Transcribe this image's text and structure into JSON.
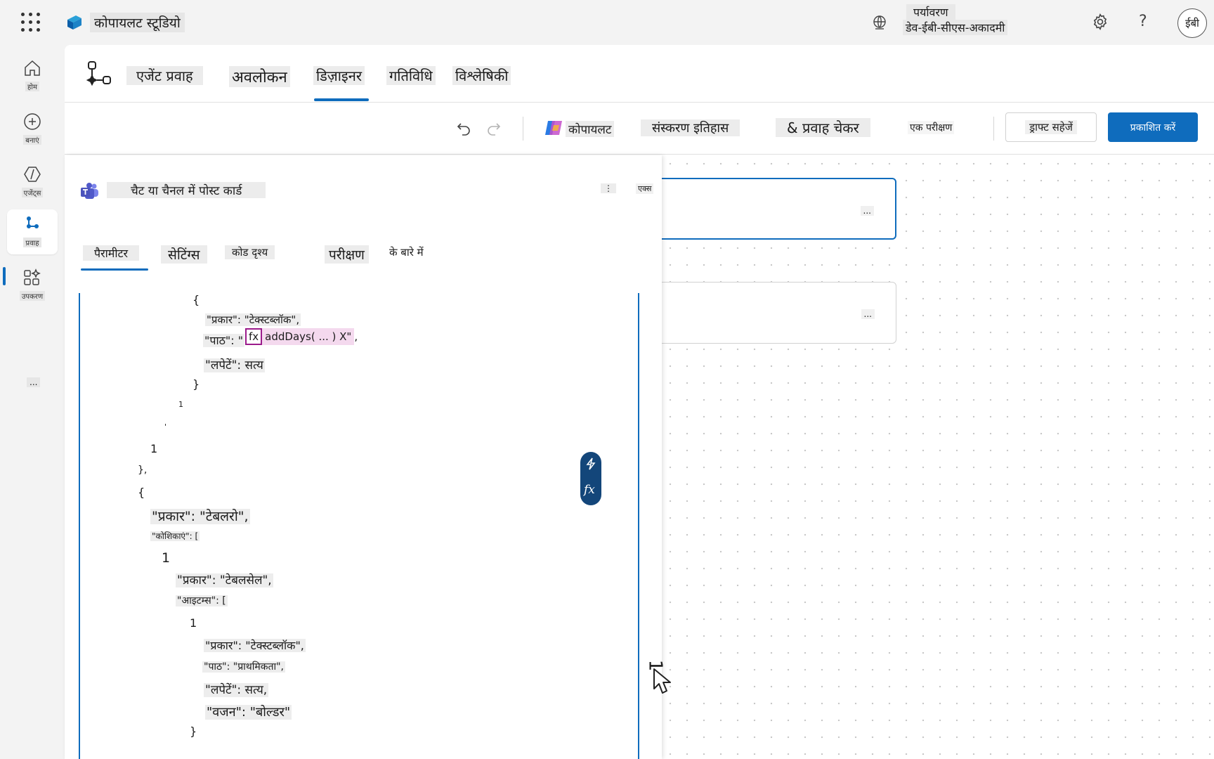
{
  "app": {
    "name": "कोपायलट स्टूडियो",
    "environment_label": "पर्यावरण",
    "environment_value": "डेव-ईबी-सीएस-अकादमी",
    "help_label": "?",
    "avatar_initials": "ईबी",
    "brand_color": "#0f6cbd"
  },
  "leftnav": {
    "items": [
      {
        "label": "होम",
        "icon": "home-icon"
      },
      {
        "label": "बनाएं",
        "icon": "plus-circle-icon"
      },
      {
        "label": "एजेंट्स",
        "icon": "agents-icon"
      },
      {
        "label": "प्रवाह",
        "icon": "flow-icon"
      },
      {
        "label": "उपकरण",
        "icon": "tools-icon"
      }
    ],
    "more": "..."
  },
  "flow_header": {
    "tabs": [
      "एजेंट प्रवाह",
      "अवलोकन",
      "डिज़ाइनर",
      "गतिविधि",
      "विश्लेषिकी"
    ],
    "active_tab": "डिज़ाइनर"
  },
  "toolbar": {
    "copilot": "कोपायलट",
    "version_history": "संस्करण इतिहास",
    "flow_checker": "& प्रवाह चेकर",
    "test": "एक परीक्षण",
    "save_draft": "ड्राफ्ट सहेजें",
    "publish": "प्रकाशित करें"
  },
  "panel": {
    "title": "चैट या चैनल में पोस्ट कार्ड",
    "more": "⋮",
    "close": "एक्स",
    "tabs": [
      "पैरामीटर",
      "सेटिंग्स",
      "कोड दृश्य",
      "परीक्षण",
      "के बारे में"
    ],
    "active_tab": "पैरामीटर"
  },
  "code": {
    "l1": "{",
    "l2": "\"प्रकार\": \"टेक्स्टब्लॉक\",",
    "l3_prefix": "\"पाठ\": \"",
    "token_fx": "fx",
    "token_body": "addDays( ... ) X\"",
    "l3_suffix": ",",
    "l4": "\"लपेटें\": सत्य",
    "l5": "}",
    "l6": "1",
    "l7": "'",
    "l8": "1",
    "l9": "},",
    "l10": "{",
    "l11": "\"प्रकार\": \"टेबलरो\",",
    "l12": "\"कोशिकाएं\": [",
    "l13": "1",
    "l14": "\"प्रकार\": \"टेबलसेल\",",
    "l15": "\"आइटम्स\": [",
    "l16": "1",
    "l17": "\"प्रकार\": \"टेक्स्टब्लॉक\",",
    "l18": "\"पाठ\": \"प्राथमिकता\",",
    "l19": "\"लपेटें\": सत्य,",
    "l20": "\"वजन\": \"बोल्डर\"",
    "l21": "}"
  },
  "fx_pill": {
    "fx": "fx"
  },
  "canvas": {
    "node_more": "..."
  },
  "cursor_glyph": "1"
}
